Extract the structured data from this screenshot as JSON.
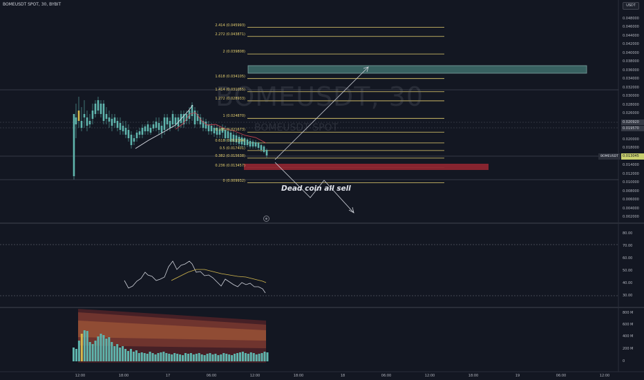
{
  "header": {
    "symbol_title": "BOMEUSDT SPOT, 30, BYBIT",
    "currency": "USDT"
  },
  "watermark": {
    "line1": "BOMEUSDT, 30",
    "line2": "BOMEUSDT SPOT"
  },
  "annotation": "Dead coin all sell",
  "fib_levels": [
    {
      "label": "2.414 (0.045993)",
      "price": 0.045993
    },
    {
      "label": "2.272 (0.043871)",
      "price": 0.043871
    },
    {
      "label": "2 (0.039808)",
      "price": 0.039808
    },
    {
      "label": "1.618 (0.034105)",
      "price": 0.034105
    },
    {
      "label": "1.414 (0.031055)",
      "price": 0.031055
    },
    {
      "label": "1.272 (0.028933)",
      "price": 0.028933
    },
    {
      "label": "1 (0.024870)",
      "price": 0.02487
    },
    {
      "label": "0.786 (0.021673)",
      "price": 0.021673
    },
    {
      "label": "0.618 (0.019164)",
      "price": 0.019164
    },
    {
      "label": "0.5 (0.017401)",
      "price": 0.017401
    },
    {
      "label": "0.382 (0.015638)",
      "price": 0.015638
    },
    {
      "label": "0.236 (0.013457)",
      "price": 0.013457
    },
    {
      "label": "0 (0.009932)",
      "price": 0.009932
    }
  ],
  "price_axis": [
    "0.048000",
    "0.046000",
    "0.044000",
    "0.042000",
    "0.040000",
    "0.038000",
    "0.036000",
    "0.034000",
    "0.032000",
    "0.030000",
    "0.028000",
    "0.026000",
    "0.024000",
    "0.022000",
    "0.020000",
    "0.018000",
    "0.016000",
    "0.014000",
    "0.012000",
    "0.010000",
    "0.008000",
    "0.006000",
    "0.004000",
    "0.002000"
  ],
  "price_tags": {
    "symbol": "BOMEUSDT",
    "current": "0.013045",
    "tag1": "0.020920",
    "tag2": "0.019570"
  },
  "rsi_axis": [
    "80.00",
    "70.00",
    "60.00",
    "50.00",
    "40.00",
    "30.00"
  ],
  "volume_axis": [
    "800 M",
    "600 M",
    "400 M",
    "200 M",
    "0"
  ],
  "time_axis": [
    "12:00",
    "18:00",
    "17",
    "06:00",
    "12:00",
    "18:00",
    "18",
    "06:00",
    "12:00",
    "18:00",
    "19",
    "06:00",
    "12:00"
  ],
  "colors": {
    "background": "#131722",
    "up": "#5fb5ad",
    "down": "#5fb5ad",
    "fib": "#e8d270",
    "target_box": "#5a8d8a",
    "stop_box": "#a52a36",
    "highlight_candle": "#d4b94e"
  }
}
